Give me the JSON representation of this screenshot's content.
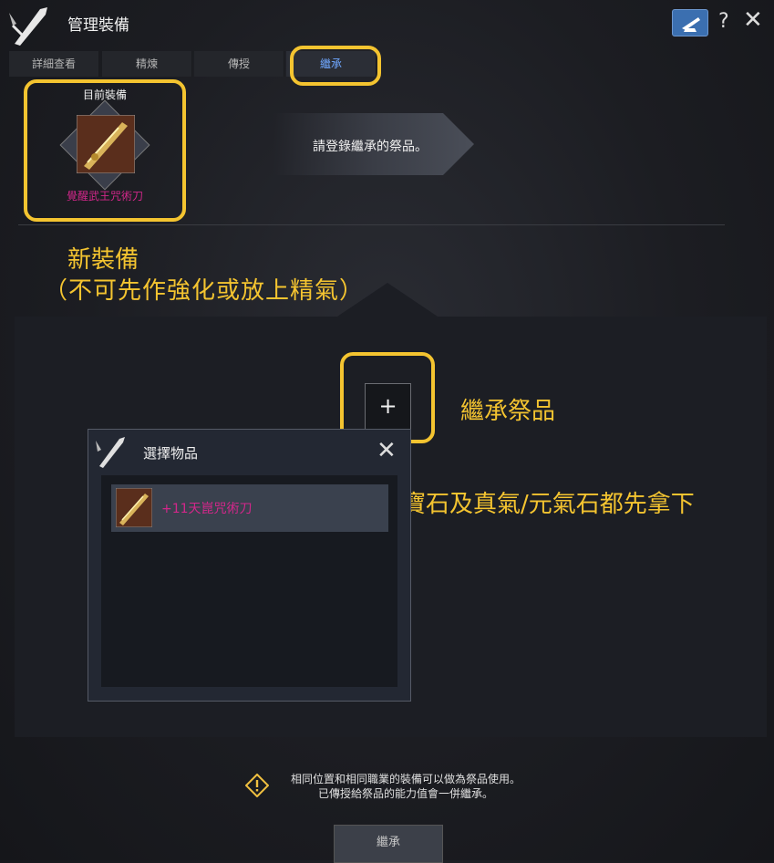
{
  "window": {
    "title": "管理裝備",
    "help": "?",
    "close": "✕"
  },
  "tabs": [
    {
      "label": "詳細查看"
    },
    {
      "label": "精煉"
    },
    {
      "label": "傳授"
    },
    {
      "label": "繼承",
      "active": true
    }
  ],
  "current_equipment": {
    "label": "目前裝備",
    "item_name": "覺醒武王咒術刀"
  },
  "prompt": "請登錄繼承的祭品。",
  "annotations": {
    "new_equipment": "新裝備",
    "new_equipment_note": "（不可先作強化或放上精氣）",
    "sacrifice": "繼承祭品",
    "gems_note": "寶石及真氣/元氣石都先拿下"
  },
  "slot": {
    "symbol": "+"
  },
  "popup": {
    "title": "選擇物品",
    "close": "✕",
    "items": [
      {
        "name": "+11天崑咒術刀"
      }
    ]
  },
  "notes": {
    "line1": "相同位置和相同職業的裝備可以做為祭品使用。",
    "line2": "已傳授給祭品的能力值會一併繼承。"
  },
  "inherit_button": "繼承",
  "colors": {
    "highlight": "#f4c430",
    "item_name": "#d2278a",
    "active_tab": "#6fa7ff"
  }
}
